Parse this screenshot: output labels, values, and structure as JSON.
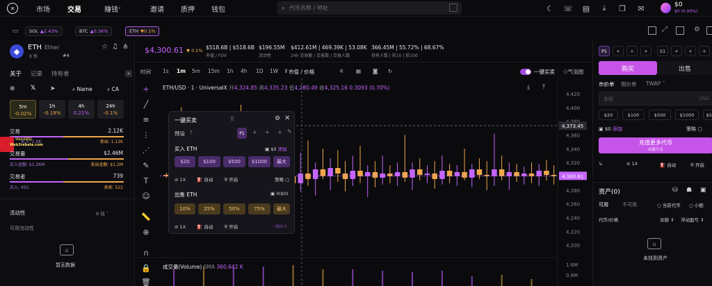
{
  "nav": {
    "items": [
      "市场",
      "交易",
      "赚钱",
      "邀请",
      "质押",
      "钱包"
    ],
    "earn_caret": "˅",
    "search_placeholder": "代币名称 / 地址",
    "balance": "$0",
    "balance_change": "$0 (0.00%)"
  },
  "tickers": [
    {
      "sym": "SOL",
      "chg": "▲2.43%"
    },
    {
      "sym": "BTC",
      "chg": "▲0.36%"
    },
    {
      "sym": "ETH",
      "chg": "▼0.1%"
    }
  ],
  "token": {
    "symbol": "ETH",
    "name": "Ether",
    "holders": "8 钱",
    "rank": "#4",
    "price": "$4,300.61",
    "price_chg": "▼ 0.1%",
    "stats": [
      {
        "v": "$518.6B | $518.6B",
        "l": "市值 / FDV"
      },
      {
        "v": "$196.55M",
        "l": "流动性"
      },
      {
        "v": "$412.61M | 469.39K | 53.08K",
        "l": "24h 交易额 | 交易数 | 交易人数"
      },
      {
        "v": "366.45M | 55.72% | 68.67%",
        "l": "持有人数 | 前10 | 前100"
      }
    ]
  },
  "left": {
    "tabs": [
      "关于",
      "记录",
      "持有者"
    ],
    "links": [
      "Name",
      "CA"
    ],
    "timeframes": [
      {
        "t": "5m",
        "v": "-0.02%"
      },
      {
        "t": "1h",
        "v": "-0.19%"
      },
      {
        "t": "4h",
        "v": "0.21%"
      },
      {
        "t": "24h",
        "v": "-0.1%"
      }
    ],
    "trades_label": "交易",
    "trades_val": "2.12K",
    "trades_buy": "买入: 1.0K",
    "trades_sell": "卖出: 1.12K",
    "vol_label": "交易量",
    "vol_val": "$2.46M",
    "vol_buy": "买入金额: $1.26M",
    "vol_sell": "卖出金额: $1.2M",
    "traders_label": "交易者",
    "traders_val": "739",
    "traders_buy": "买入: 455",
    "traders_sell": "卖家: 522",
    "liq_label": "流动性",
    "liq_badge": "8 钱",
    "pool_label": "可用流动性",
    "empty": "暂无数据",
    "watermark_a": "Web3网站",
    "watermark_b": "Web3rebate.com"
  },
  "chart": {
    "time_label": "时间",
    "intervals": [
      "1s",
      "1m",
      "5m",
      "15m",
      "1h",
      "4h",
      "1D",
      "1W"
    ],
    "active_interval": "1m",
    "mode": "市值 / 价格",
    "quick_buy_toggle": "一键买卖",
    "bubble": "气泡图",
    "pair": "ETH/USD · 1 · UniversalX",
    "o_lbl": "开",
    "o": "4,324.85",
    "h_lbl": "高",
    "h": "4,335.23",
    "l_lbl": "低",
    "l": "4,280.49",
    "c_lbl": "收",
    "c": "4,325.16",
    "chg": "0.3093 (0.70%)",
    "crosshair_price": "4,373.45",
    "last_price": "4,300.61",
    "y_ticks": [
      "4,420",
      "4,400",
      "4,380",
      "4,360",
      "4,340",
      "4,320",
      "4,300",
      "4,280",
      "4,260",
      "4,240",
      "4,220",
      "4,200"
    ],
    "vol_ticks": [
      "1.6M",
      "0.8M"
    ],
    "volume_label": "成交量(Volume)",
    "sma": "SMA",
    "vol_val": "360.642 K"
  },
  "chart_data": {
    "type": "candlestick",
    "title": "ETH/USD · 1 · UniversalX",
    "ylim": [
      4190,
      4430
    ],
    "last": 4300.61,
    "candles": [
      [
        4302,
        4305,
        4298,
        4300
      ],
      [
        4300,
        4352,
        4280,
        4318
      ],
      [
        4318,
        4400,
        4290,
        4310
      ],
      [
        4310,
        4330,
        4270,
        4285
      ],
      [
        4285,
        4320,
        4262,
        4305
      ],
      [
        4305,
        4340,
        4292,
        4298
      ],
      [
        4298,
        4380,
        4270,
        4320
      ],
      [
        4320,
        4355,
        4300,
        4312
      ],
      [
        4312,
        4345,
        4292,
        4296
      ],
      [
        4296,
        4322,
        4275,
        4310
      ],
      [
        4310,
        4404,
        4284,
        4302
      ],
      [
        4302,
        4328,
        4272,
        4316
      ],
      [
        4316,
        4340,
        4290,
        4300
      ],
      [
        4300,
        4360,
        4284,
        4306
      ],
      [
        4306,
        4322,
        4280,
        4296
      ],
      [
        4296,
        4340,
        4274,
        4312
      ],
      [
        4312,
        4350,
        4292,
        4300
      ],
      [
        4300,
        4320,
        4270,
        4290
      ],
      [
        4290,
        4334,
        4278,
        4304
      ],
      [
        4304,
        4352,
        4286,
        4296
      ],
      [
        4296,
        4320,
        4272,
        4310
      ],
      [
        4310,
        4340,
        4296,
        4300
      ],
      [
        4300,
        4326,
        4280,
        4312
      ],
      [
        4312,
        4338,
        4292,
        4304
      ],
      [
        4304,
        4322,
        4278,
        4296
      ],
      [
        4296,
        4330,
        4286,
        4308
      ],
      [
        4308,
        4344,
        4290,
        4300
      ],
      [
        4300,
        4316,
        4270,
        4306
      ],
      [
        4306,
        4322,
        4284,
        4298
      ],
      [
        4298,
        4330,
        4288,
        4304
      ],
      [
        4304,
        4316,
        4290,
        4300
      ],
      [
        4300,
        4320,
        4286,
        4306
      ],
      [
        4306,
        4360,
        4292,
        4298
      ],
      [
        4298,
        4320,
        4280,
        4310
      ],
      [
        4310,
        4326,
        4294,
        4302
      ],
      [
        4302,
        4316,
        4290,
        4304
      ],
      [
        4304,
        4322,
        4282,
        4296
      ],
      [
        4296,
        4330,
        4288,
        4308
      ],
      [
        4308,
        4318,
        4290,
        4300
      ],
      [
        4300,
        4316,
        4286,
        4306
      ],
      [
        4306,
        4340,
        4294,
        4298
      ],
      [
        4298,
        4318,
        4284,
        4310
      ],
      [
        4310,
        4326,
        4296,
        4302
      ],
      [
        4302,
        4322,
        4280,
        4300
      ],
      [
        4300,
        4362,
        4286,
        4310
      ],
      [
        4310,
        4330,
        4294,
        4300
      ],
      [
        4300,
        4320,
        4280,
        4306
      ],
      [
        4306,
        4318,
        4292,
        4300
      ],
      [
        4300,
        4314,
        4288,
        4304
      ],
      [
        4304,
        4320,
        4290,
        4300
      ],
      [
        4300,
        4318,
        4286,
        4308
      ],
      [
        4308,
        4324,
        4294,
        4302
      ],
      [
        4302,
        4316,
        4288,
        4300
      ]
    ]
  },
  "popup": {
    "title": "一键买卖",
    "preset": "预设",
    "p1": "P1",
    "buy_title": "买入 ETH",
    "buy_bal": "$0",
    "buy_add": "添加",
    "buy_amounts": [
      "$20",
      "$100",
      "$500",
      "$1000",
      "最大"
    ],
    "opts": [
      "1X",
      "自动",
      "开启"
    ],
    "strategy": "策略",
    "sell_title": "出售 ETH",
    "sell_bal": "0($0)",
    "sell_amounts": [
      "10%",
      "25%",
      "50%",
      "75%",
      "最大"
    ],
    "sell_link": "一键出卡"
  },
  "trade": {
    "presets": [
      "P1",
      "S1"
    ],
    "buy": "购买",
    "sell": "出售",
    "types": [
      "市价单",
      "限价单",
      "TWAP"
    ],
    "amount_placeholder": "金额",
    "currency": "USD",
    "amounts": [
      "$20",
      "$100",
      "$500",
      "$1000",
      "$5000"
    ],
    "bal": "$0",
    "add": "添加",
    "strategy": "策略",
    "cta": "充值更多代币",
    "cta_sub": "余额不足",
    "opts": [
      "1X",
      "自动",
      "开启"
    ]
  },
  "assets": {
    "title": "资产(0)",
    "tabs": [
      "可用",
      "不可用"
    ],
    "filters": [
      "当前代币",
      "小额"
    ],
    "cols": [
      "代币/价格",
      "余额",
      "浮动盈亏"
    ],
    "empty": "未找到资产"
  }
}
